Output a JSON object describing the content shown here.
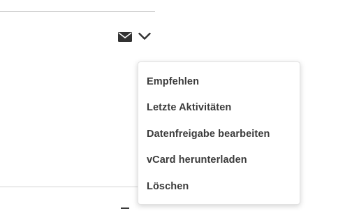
{
  "toolbar": {
    "mail_icon": "envelope-icon",
    "more_icon": "chevron-down-icon"
  },
  "dropdown": {
    "items": [
      {
        "label": "Empfehlen"
      },
      {
        "label": "Letzte Aktivitäten"
      },
      {
        "label": "Datenfreigabe bearbeiten"
      },
      {
        "label": "vCard herunterladen"
      },
      {
        "label": "Löschen"
      }
    ]
  },
  "colors": {
    "text": "#3b3b3b",
    "icon": "#333333",
    "divider": "#d3d3d3",
    "menu_border": "#e2e2e2",
    "background": "#ffffff"
  }
}
